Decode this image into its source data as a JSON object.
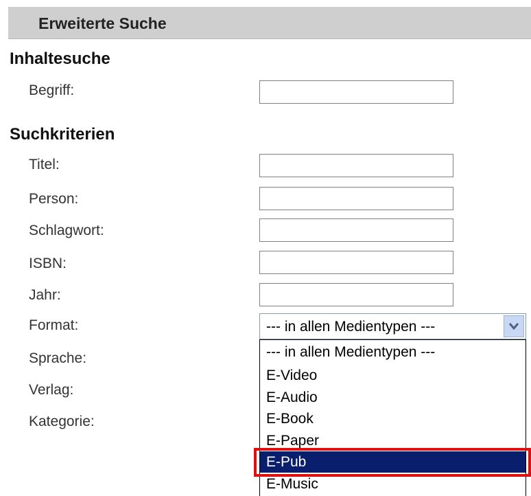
{
  "header": {
    "title": "Erweiterte Suche"
  },
  "sections": {
    "content": "Inhaltesuche",
    "criteria": "Suchkriterien"
  },
  "fields": {
    "begriff": {
      "label": "Begriff:",
      "value": ""
    },
    "titel": {
      "label": "Titel:",
      "value": ""
    },
    "person": {
      "label": "Person:",
      "value": ""
    },
    "schlagwort": {
      "label": "Schlagwort:",
      "value": ""
    },
    "isbn": {
      "label": "ISBN:",
      "value": ""
    },
    "jahr": {
      "label": "Jahr:",
      "value": ""
    }
  },
  "labels": {
    "format": "Format:",
    "sprache": "Sprache:",
    "verlag": "Verlag:",
    "kategorie": "Kategorie:"
  },
  "format_select": {
    "selected": "--- in allen Medientypen ---",
    "options": [
      "--- in allen Medientypen ---",
      "E-Video",
      "E-Audio",
      "E-Book",
      "E-Paper",
      "E-Pub",
      "E-Music"
    ],
    "highlighted": "E-Pub"
  },
  "colors": {
    "header_bg": "#cfcfcf",
    "selected_option_bg": "#0a1e6e",
    "annotation_box": "#e01010"
  }
}
